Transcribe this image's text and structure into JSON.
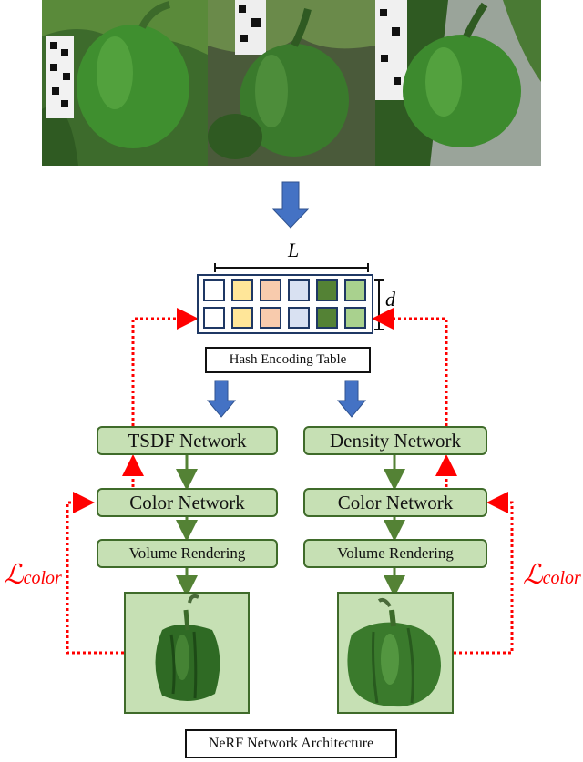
{
  "photos": [
    {
      "name": "pepper-view-1",
      "description": "green bell pepper on plant with marker tag"
    },
    {
      "name": "pepper-view-2",
      "description": "green bell pepper on plant, side view"
    },
    {
      "name": "pepper-view-3",
      "description": "green bell pepper on plant, greenhouse background"
    }
  ],
  "hash_table": {
    "length_label": "L",
    "depth_label": "d",
    "caption": "Hash Encoding Table",
    "cell_colors": [
      "#ffffff",
      "#ffe699",
      "#f8cbad",
      "#d9e1f2",
      "#548235",
      "#a9d18e"
    ],
    "rows": 2
  },
  "left_branch": {
    "geometry_network": "TSDF Network",
    "color_network": "Color Network",
    "rendering": "Volume Rendering",
    "loss_label": {
      "symbol": "ℒ",
      "subscript": "color"
    }
  },
  "right_branch": {
    "geometry_network": "Density Network",
    "color_network": "Color Network",
    "rendering": "Volume Rendering",
    "loss_label": {
      "symbol": "ℒ",
      "subscript": "color"
    }
  },
  "caption": "NeRF Network Architecture",
  "colors": {
    "box_fill": "#c6e0b4",
    "box_border": "#3f6b2a",
    "flow_arrow": "#548235",
    "loss_arrow": "#ff0000",
    "block_arrow": "#4472c4",
    "hash_border": "#1f3864"
  }
}
